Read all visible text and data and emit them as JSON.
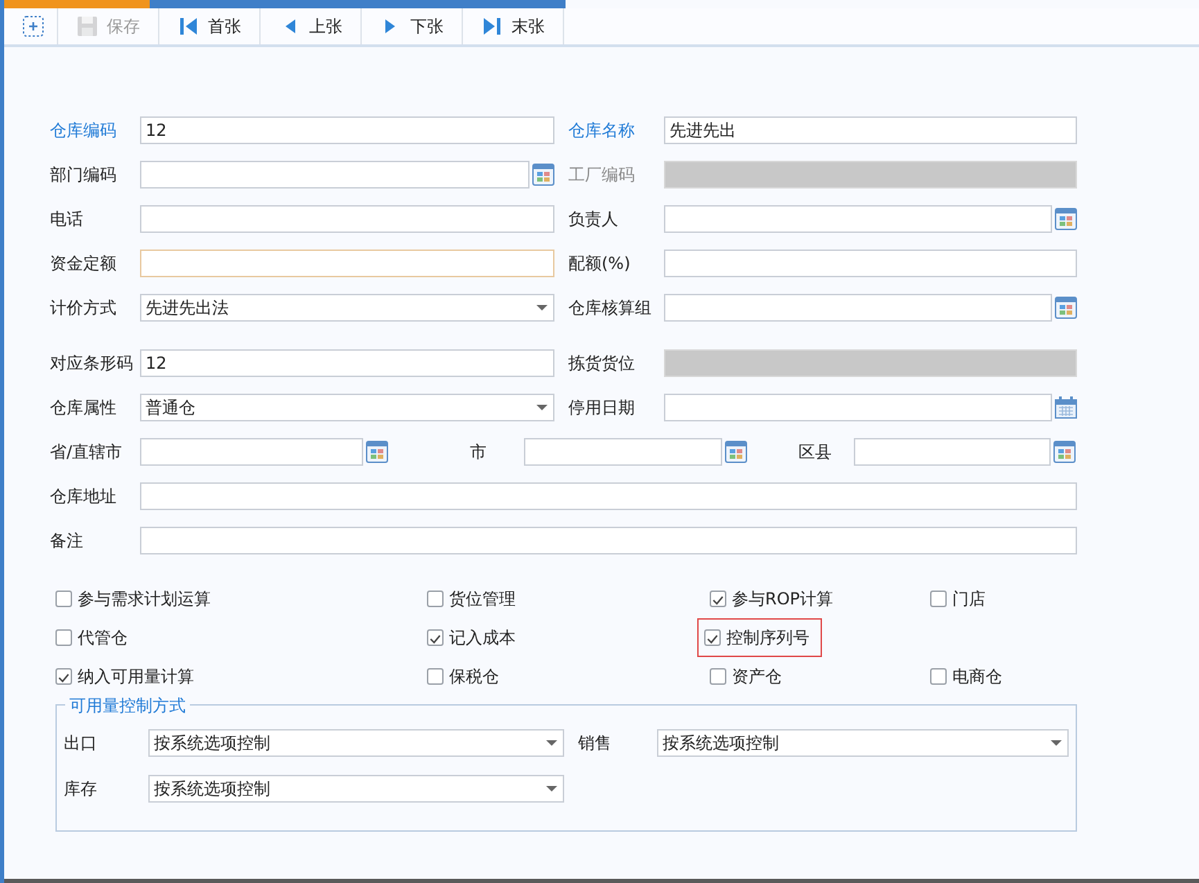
{
  "toolbar": [
    {
      "kind": "new",
      "disabled": false
    },
    {
      "kind": "save",
      "label": "保存",
      "disabled": true
    },
    {
      "kind": "first",
      "label": "首张",
      "disabled": false
    },
    {
      "kind": "prev",
      "label": "上张",
      "disabled": false
    },
    {
      "kind": "next",
      "label": "下张",
      "disabled": false
    },
    {
      "kind": "last",
      "label": "末张",
      "disabled": false
    }
  ],
  "form": {
    "rows": [
      {
        "kind": "pair",
        "fields": [
          {
            "label": "仓库编码",
            "required": true,
            "disabled": false,
            "kind": "text",
            "value": "12",
            "focused": false
          },
          {
            "label": "仓库名称",
            "required": true,
            "disabled": false,
            "kind": "text",
            "value": "先进先出",
            "focused": false
          }
        ]
      },
      {
        "kind": "pair",
        "fields": [
          {
            "label": "部门编码",
            "required": false,
            "disabled": false,
            "kind": "lookup",
            "focused": false
          },
          {
            "label": "工厂编码",
            "required": false,
            "disabled": true,
            "kind": "readonly",
            "focused": false
          }
        ]
      },
      {
        "kind": "pair",
        "fields": [
          {
            "label": "电话",
            "required": false,
            "disabled": false,
            "kind": "text",
            "focused": false
          },
          {
            "label": "负责人",
            "required": false,
            "disabled": false,
            "kind": "lookup",
            "focused": false
          }
        ]
      },
      {
        "kind": "pair",
        "fields": [
          {
            "label": "资金定额",
            "required": false,
            "disabled": false,
            "kind": "text",
            "focused": true
          },
          {
            "label": "配额(%)",
            "required": false,
            "disabled": false,
            "kind": "text",
            "focused": false
          }
        ]
      },
      {
        "kind": "pair",
        "fields": [
          {
            "label": "计价方式",
            "required": false,
            "disabled": false,
            "kind": "select",
            "value": "先进先出法",
            "focused": false
          },
          {
            "label": "仓库核算组",
            "required": false,
            "disabled": false,
            "kind": "lookup",
            "focused": false
          }
        ]
      },
      {
        "kind": "pair",
        "fields": [
          {
            "label": "对应条形码",
            "required": false,
            "disabled": false,
            "kind": "text",
            "value": "12",
            "focused": false
          },
          {
            "label": "拣货货位",
            "required": false,
            "disabled": false,
            "kind": "readonly",
            "focused": false
          }
        ]
      },
      {
        "kind": "pair",
        "fields": [
          {
            "label": "仓库属性",
            "required": false,
            "disabled": false,
            "kind": "select",
            "value": "普通仓",
            "focused": false
          },
          {
            "label": "停用日期",
            "required": false,
            "disabled": false,
            "kind": "date",
            "focused": false
          }
        ]
      },
      {
        "kind": "triple",
        "fields": [
          {
            "label": "省/直辖市",
            "required": false,
            "disabled": false,
            "kind": "lookup",
            "focused": false
          },
          {
            "label": "市",
            "required": false,
            "disabled": false,
            "kind": "lookup",
            "focused": false
          },
          {
            "label": "区县",
            "required": false,
            "disabled": false,
            "kind": "lookup",
            "focused": false
          }
        ]
      },
      {
        "kind": "full",
        "fields": [
          {
            "label": "仓库地址",
            "required": false,
            "disabled": false,
            "kind": "text",
            "focused": false
          }
        ]
      },
      {
        "kind": "full",
        "fields": [
          {
            "label": "备注",
            "required": false,
            "disabled": false,
            "kind": "text",
            "focused": false
          }
        ]
      }
    ]
  },
  "options": [
    {
      "items": [
        {
          "label": "参与需求计划运算",
          "checked": false,
          "highlighted": false
        },
        {
          "label": "货位管理",
          "checked": false,
          "highlighted": false
        },
        {
          "label": "参与ROP计算",
          "checked": true,
          "highlighted": false
        },
        {
          "label": "门店",
          "checked": false,
          "highlighted": false
        }
      ]
    },
    {
      "items": [
        {
          "label": "代管仓",
          "checked": false,
          "highlighted": false
        },
        {
          "label": "记入成本",
          "checked": true,
          "highlighted": false
        },
        {
          "label": "控制序列号",
          "checked": true,
          "highlighted": true
        }
      ]
    },
    {
      "items": [
        {
          "label": "纳入可用量计算",
          "checked": true,
          "highlighted": false
        },
        {
          "label": "保税仓",
          "checked": false,
          "highlighted": false
        },
        {
          "label": "资产仓",
          "checked": false,
          "highlighted": false
        },
        {
          "label": "电商仓",
          "checked": false,
          "highlighted": false
        }
      ]
    }
  ],
  "availability_control": {
    "title": "可用量控制方式",
    "rows": [
      {
        "fields": [
          {
            "label": "出口",
            "value": "按系统选项控制"
          },
          {
            "label": "销售",
            "value": "按系统选项控制"
          }
        ]
      },
      {
        "fields": [
          {
            "label": "库存",
            "value": "按系统选项控制"
          }
        ]
      }
    ]
  }
}
